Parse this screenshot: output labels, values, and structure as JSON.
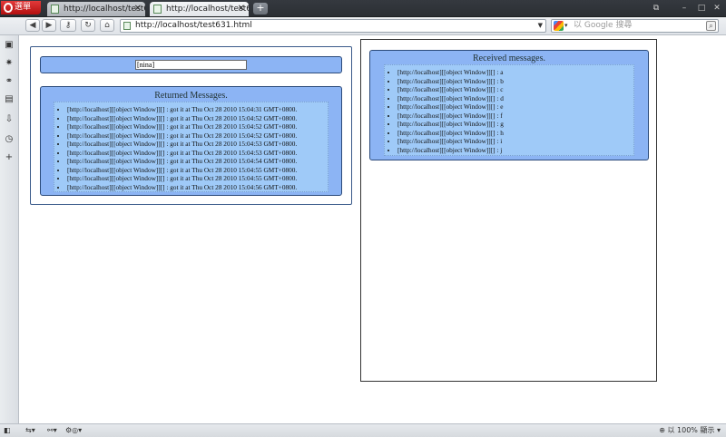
{
  "browser": {
    "menu_label": "選單",
    "tabs": [
      {
        "label": "http://localhost/test6...",
        "active": false
      },
      {
        "label": "http://localhost/test6...",
        "active": true
      }
    ],
    "new_tab_label": "+",
    "address": "http://localhost/test631.html",
    "search_placeholder": "以 Google 搜尋",
    "zoom": "100%",
    "zoom_label": "以 100% 顯示"
  },
  "page": {
    "input_value": "[nina]",
    "returned": {
      "title": "Returned Messages.",
      "items": [
        "[http://localhost][[object Window]][] : got it at Thu Oct 28 2010 15:04:31 GMT+0800.",
        "[http://localhost][[object Window]][] : got it at Thu Oct 28 2010 15:04:52 GMT+0800.",
        "[http://localhost][[object Window]][] : got it at Thu Oct 28 2010 15:04:52 GMT+0800.",
        "[http://localhost][[object Window]][] : got it at Thu Oct 28 2010 15:04:52 GMT+0800.",
        "[http://localhost][[object Window]][] : got it at Thu Oct 28 2010 15:04:53 GMT+0800.",
        "[http://localhost][[object Window]][] : got it at Thu Oct 28 2010 15:04:53 GMT+0800.",
        "[http://localhost][[object Window]][] : got it at Thu Oct 28 2010 15:04:54 GMT+0800.",
        "[http://localhost][[object Window]][] : got it at Thu Oct 28 2010 15:04:55 GMT+0800.",
        "[http://localhost][[object Window]][] : got it at Thu Oct 28 2010 15:04:55 GMT+0800.",
        "[http://localhost][[object Window]][] : got it at Thu Oct 28 2010 15:04:56 GMT+0800."
      ]
    },
    "received": {
      "title": "Received messages.",
      "items": [
        "[http://localhost][[object Window]][] : a",
        "[http://localhost][[object Window]][] : b",
        "[http://localhost][[object Window]][] : c",
        "[http://localhost][[object Window]][] : d",
        "[http://localhost][[object Window]][] : e",
        "[http://localhost][[object Window]][] : f",
        "[http://localhost][[object Window]][] : g",
        "[http://localhost][[object Window]][] : h",
        "[http://localhost][[object Window]][] : i",
        "[http://localhost][[object Window]][] : j"
      ]
    }
  },
  "colors": {
    "panel_blue": "#8cb4f4",
    "list_blue": "#9fcaf8",
    "panel_border": "#2b4a7a"
  }
}
